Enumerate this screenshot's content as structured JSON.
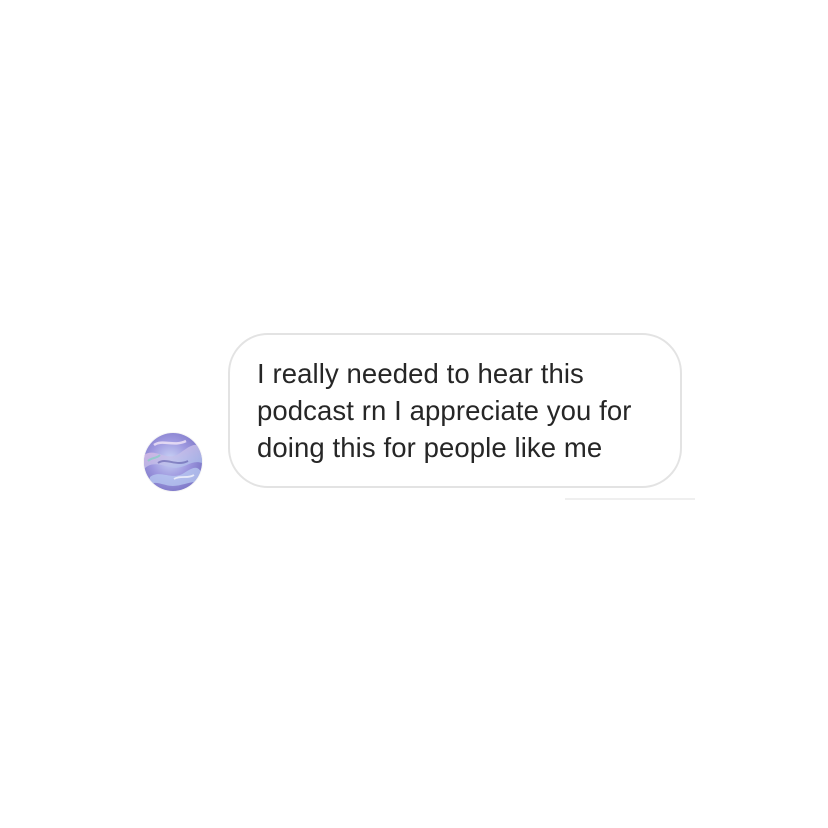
{
  "message": {
    "lines": [
      "I really needed to hear this",
      "podcast rn I appreciate you for",
      "doing this for people like me"
    ]
  },
  "avatar": {
    "icon": "holographic-profile-picture",
    "colors": [
      "#8f8ad6",
      "#b9c5f2",
      "#d3a6d8",
      "#7b77c7"
    ]
  },
  "theme": {
    "background": "#ffffff",
    "bubble_border": "#e3e3e3",
    "text": "#262626"
  }
}
